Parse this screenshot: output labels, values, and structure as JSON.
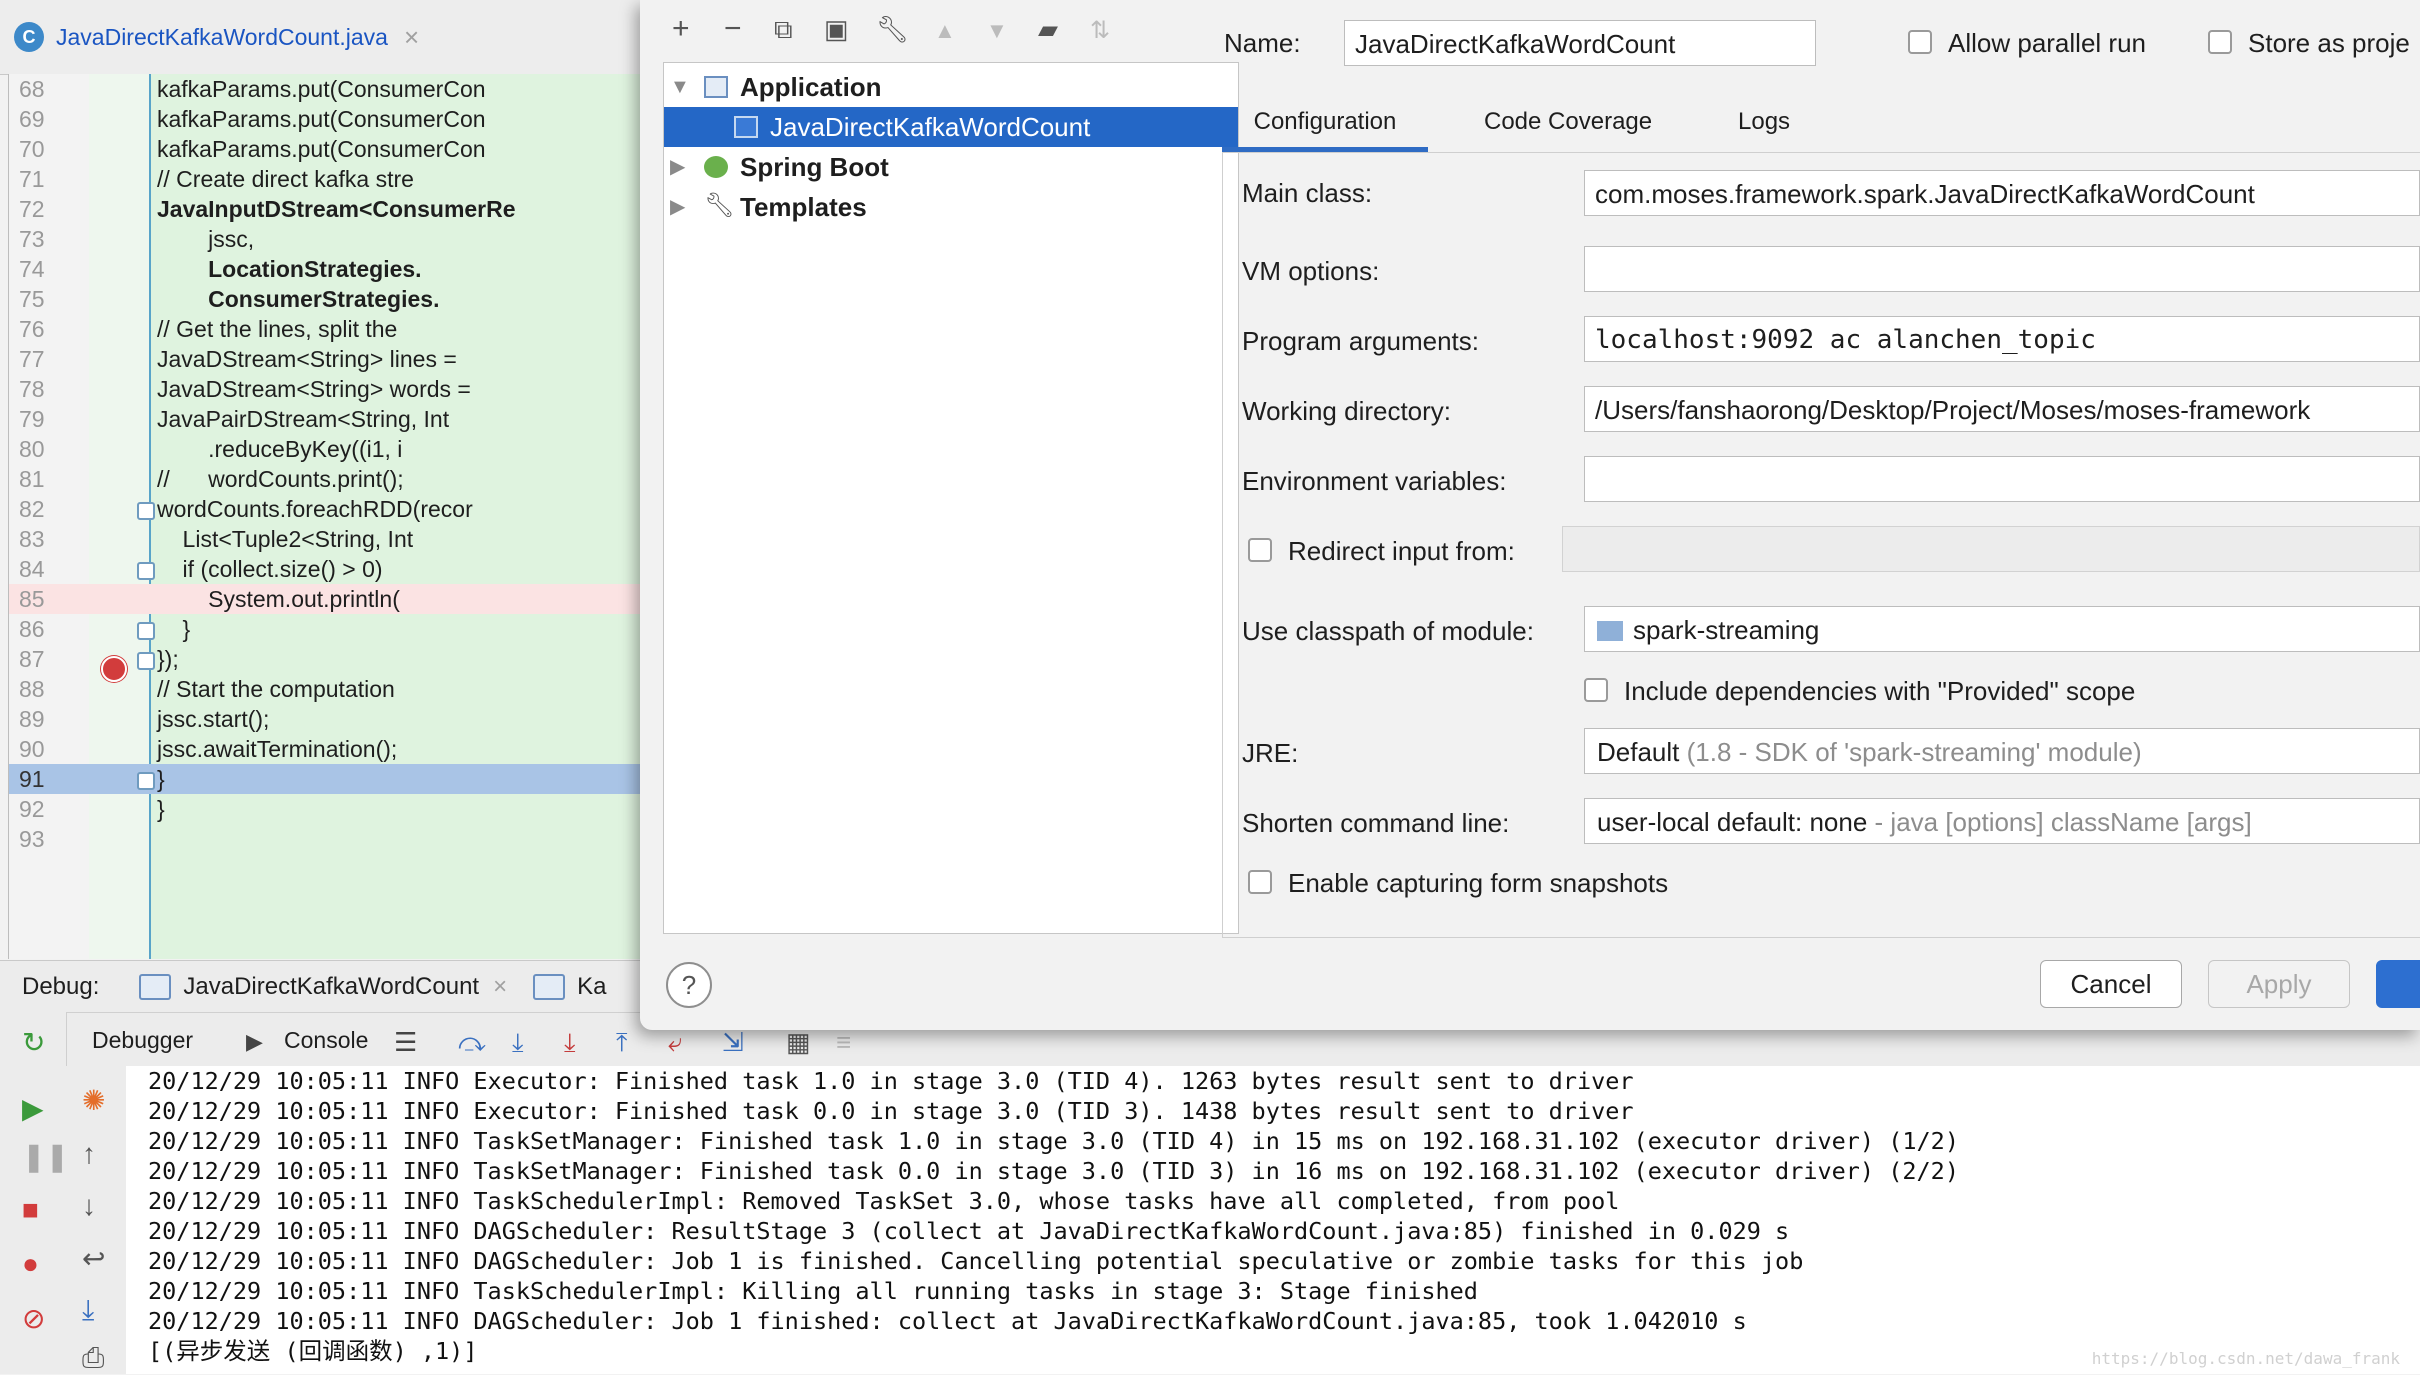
{
  "editor": {
    "tab_title": "JavaDirectKafkaWordCount.java",
    "tab_icon": "C",
    "lines": [
      {
        "num": "68",
        "text": "kafkaParams.put(ConsumerCon"
      },
      {
        "num": "69",
        "text": "kafkaParams.put(ConsumerCon"
      },
      {
        "num": "70",
        "text": "kafkaParams.put(ConsumerCon"
      },
      {
        "num": "71",
        "text": "// Create direct kafka stre"
      },
      {
        "num": "72",
        "text": "JavaInputDStream<ConsumerRe"
      },
      {
        "num": "73",
        "text": "        jssc,"
      },
      {
        "num": "74",
        "text": "        LocationStrategies."
      },
      {
        "num": "75",
        "text": "        ConsumerStrategies."
      },
      {
        "num": "76",
        "text": "// Get the lines, split the"
      },
      {
        "num": "77",
        "text": "JavaDStream<String> lines ="
      },
      {
        "num": "78",
        "text": "JavaDStream<String> words ="
      },
      {
        "num": "79",
        "text": "JavaPairDStream<String, Int"
      },
      {
        "num": "80",
        "text": "        .reduceByKey((i1, i"
      },
      {
        "num": "81",
        "text": "//      wordCounts.print();"
      },
      {
        "num": "82",
        "text": "wordCounts.foreachRDD(recor"
      },
      {
        "num": "83",
        "text": "    List<Tuple2<String, Int"
      },
      {
        "num": "84",
        "text": "    if (collect.size() > 0)"
      },
      {
        "num": "85",
        "text": "        System.out.println("
      },
      {
        "num": "86",
        "text": "    }"
      },
      {
        "num": "87",
        "text": "});"
      },
      {
        "num": "88",
        "text": "// Start the computation"
      },
      {
        "num": "89",
        "text": "jssc.start();"
      },
      {
        "num": "90",
        "text": "jssc.awaitTermination();"
      },
      {
        "num": "91",
        "text": "}"
      },
      {
        "num": "92",
        "text": "}"
      },
      {
        "num": "93",
        "text": ""
      }
    ]
  },
  "debug": {
    "label": "Debug:",
    "session_name": "JavaDirectKafkaWordCount",
    "session2_name": "Ka",
    "tab_debugger": "Debugger",
    "tab_console": "Console",
    "console_lines": [
      "20/12/29 10:05:11 INFO Executor: Finished task 1.0 in stage 3.0 (TID 4). 1263 bytes result sent to driver",
      "20/12/29 10:05:11 INFO Executor: Finished task 0.0 in stage 3.0 (TID 3). 1438 bytes result sent to driver",
      "20/12/29 10:05:11 INFO TaskSetManager: Finished task 1.0 in stage 3.0 (TID 4) in 15 ms on 192.168.31.102 (executor driver) (1/2)",
      "20/12/29 10:05:11 INFO TaskSetManager: Finished task 0.0 in stage 3.0 (TID 3) in 16 ms on 192.168.31.102 (executor driver) (2/2)",
      "20/12/29 10:05:11 INFO TaskSchedulerImpl: Removed TaskSet 3.0, whose tasks have all completed, from pool",
      "20/12/29 10:05:11 INFO DAGScheduler: ResultStage 3 (collect at JavaDirectKafkaWordCount.java:85) finished in 0.029 s",
      "20/12/29 10:05:11 INFO DAGScheduler: Job 1 is finished. Cancelling potential speculative or zombie tasks for this job",
      "20/12/29 10:05:11 INFO TaskSchedulerImpl: Killing all running tasks in stage 3: Stage finished",
      "20/12/29 10:05:11 INFO DAGScheduler: Job 1 finished: collect at JavaDirectKafkaWordCount.java:85, took 1.042010 s",
      "[(异步发送 (回调函数) ,1)]"
    ],
    "watermark": "https://blog.csdn.net/dawa_frank"
  },
  "dialog": {
    "tree": {
      "items": [
        {
          "label": "Application"
        },
        {
          "label": "JavaDirectKafkaWordCount"
        },
        {
          "label": "Spring Boot"
        },
        {
          "label": "Templates"
        }
      ]
    },
    "help_label": "?",
    "name_label": "Name:",
    "name_value": "JavaDirectKafkaWordCount",
    "allow_parallel": "Allow parallel run",
    "store_as_project": "Store as proje",
    "tabs": [
      "Configuration",
      "Code Coverage",
      "Logs"
    ],
    "main_class_label": "Main class:",
    "main_class_value": "com.moses.framework.spark.JavaDirectKafkaWordCount",
    "vm_options_label": "VM options:",
    "vm_options_value": "",
    "program_args_label": "Program arguments:",
    "program_args_value": "localhost:9092 ac alanchen_topic",
    "working_dir_label": "Working directory:",
    "working_dir_value": "/Users/fanshaorong/Desktop/Project/Moses/moses-framework",
    "env_vars_label": "Environment variables:",
    "env_vars_value": "",
    "redirect_input_label": "Redirect input from:",
    "classpath_label": "Use classpath of module:",
    "classpath_value": "spark-streaming",
    "include_deps_label": "Include dependencies with \"Provided\" scope",
    "jre_label": "JRE:",
    "jre_value": "Default",
    "jre_hint": "(1.8 - SDK of 'spark-streaming' module)",
    "shorten_label": "Shorten command line:",
    "shorten_value": "user-local default: none",
    "shorten_hint": "- java [options] className [args]",
    "capture_snapshots_label": "Enable capturing form snapshots",
    "cancel_label": "Cancel",
    "apply_label": "Apply"
  },
  "colors": {
    "accent": "#2467c6",
    "editor_bg": "#dff3df",
    "breakpoint_line": "#fbe3e3",
    "current_line": "#a9c4e6"
  }
}
